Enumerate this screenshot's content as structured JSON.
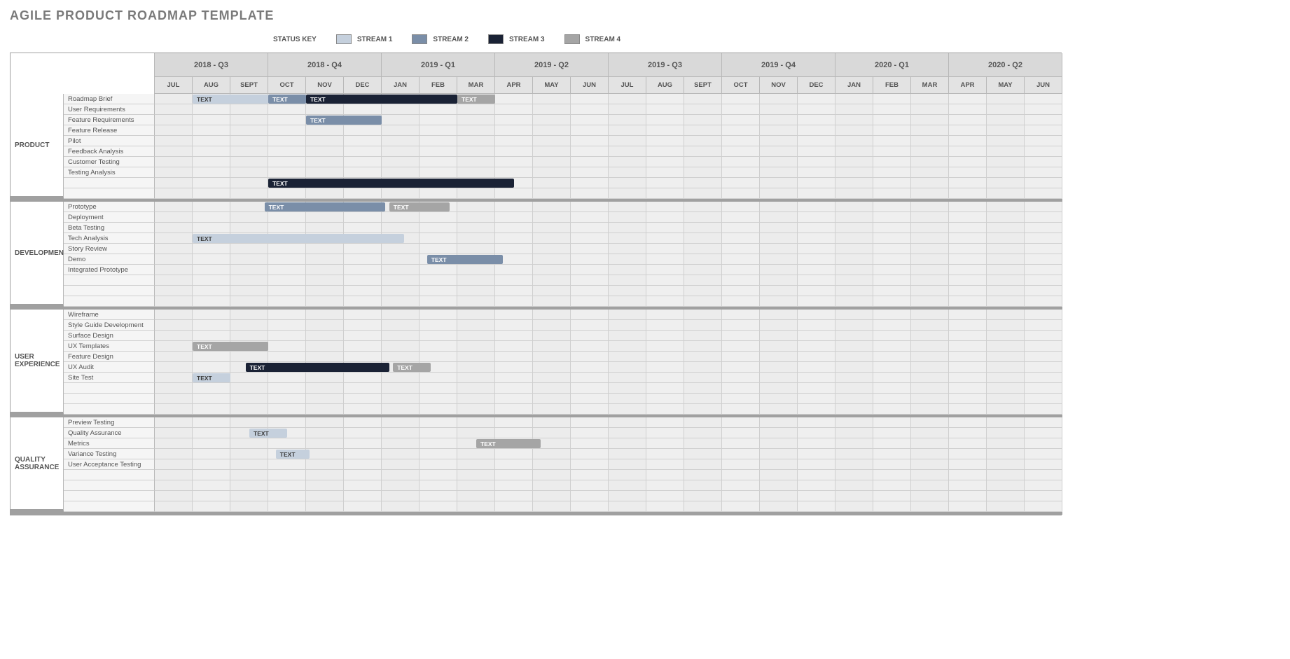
{
  "title": "AGILE PRODUCT ROADMAP TEMPLATE",
  "legend": {
    "key": "STATUS KEY",
    "items": [
      {
        "label": "STREAM 1",
        "cls": "s1"
      },
      {
        "label": "STREAM 2",
        "cls": "s2"
      },
      {
        "label": "STREAM 3",
        "cls": "s3"
      },
      {
        "label": "STREAM 4",
        "cls": "s4"
      }
    ]
  },
  "quarters": [
    "2018 - Q3",
    "2018 - Q4",
    "2019 - Q1",
    "2019 - Q2",
    "2019 - Q3",
    "2019 - Q4",
    "2020 - Q1",
    "2020 - Q2"
  ],
  "months": [
    "JUL",
    "AUG",
    "SEPT",
    "OCT",
    "NOV",
    "DEC",
    "JAN",
    "FEB",
    "MAR",
    "APR",
    "MAY",
    "JUN",
    "JUL",
    "AUG",
    "SEPT",
    "OCT",
    "NOV",
    "DEC",
    "JAN",
    "FEB",
    "MAR",
    "APR",
    "MAY",
    "JUN"
  ],
  "chart_data": {
    "type": "gantt",
    "x_unit": "month-index (0=JUL 2018)",
    "months": [
      "JUL",
      "AUG",
      "SEPT",
      "OCT",
      "NOV",
      "DEC",
      "JAN",
      "FEB",
      "MAR",
      "APR",
      "MAY",
      "JUN",
      "JUL",
      "AUG",
      "SEPT",
      "OCT",
      "NOV",
      "DEC",
      "JAN",
      "FEB",
      "MAR",
      "APR",
      "MAY",
      "JUN"
    ],
    "quarters": [
      "2018 - Q3",
      "2018 - Q4",
      "2019 - Q1",
      "2019 - Q2",
      "2019 - Q3",
      "2019 - Q4",
      "2020 - Q1",
      "2020 - Q2"
    ],
    "streams": {
      "s1": "STREAM 1",
      "s2": "STREAM 2",
      "s3": "STREAM 3",
      "s4": "STREAM 4"
    },
    "sections": [
      {
        "name": "PRODUCT",
        "rows": [
          {
            "task": "Roadmap Brief",
            "bars": [
              {
                "start": 1.0,
                "span": 2.0,
                "stream": "s1",
                "text": "TEXT"
              },
              {
                "start": 3.0,
                "span": 1.0,
                "stream": "s2",
                "text": "TEXT"
              },
              {
                "start": 4.0,
                "span": 4.0,
                "stream": "s3",
                "text": "TEXT"
              },
              {
                "start": 8.0,
                "span": 1.0,
                "stream": "s4",
                "text": "TEXT"
              }
            ]
          },
          {
            "task": "User Requirements",
            "bars": []
          },
          {
            "task": "Feature Requirements",
            "bars": [
              {
                "start": 4.0,
                "span": 2.0,
                "stream": "s2",
                "text": "TEXT"
              }
            ]
          },
          {
            "task": "Feature Release",
            "bars": []
          },
          {
            "task": "Pilot",
            "bars": []
          },
          {
            "task": "Feedback Analysis",
            "bars": []
          },
          {
            "task": "Customer Testing",
            "bars": []
          },
          {
            "task": "Testing Analysis",
            "bars": []
          },
          {
            "task": "",
            "bars": [
              {
                "start": 3.0,
                "span": 6.5,
                "stream": "s3",
                "text": "TEXT"
              }
            ]
          },
          {
            "task": "",
            "bars": []
          }
        ]
      },
      {
        "name": "DEVELOPMENT",
        "rows": [
          {
            "task": "Prototype",
            "bars": [
              {
                "start": 2.9,
                "span": 3.2,
                "stream": "s2",
                "text": "TEXT"
              },
              {
                "start": 6.2,
                "span": 1.6,
                "stream": "s4",
                "text": "TEXT"
              }
            ]
          },
          {
            "task": "Deployment",
            "bars": []
          },
          {
            "task": "Beta Testing",
            "bars": []
          },
          {
            "task": "Tech Analysis",
            "bars": [
              {
                "start": 1.0,
                "span": 5.6,
                "stream": "s1",
                "text": "TEXT"
              }
            ]
          },
          {
            "task": "Story Review",
            "bars": []
          },
          {
            "task": "Demo",
            "bars": [
              {
                "start": 7.2,
                "span": 2.0,
                "stream": "s2",
                "text": "TEXT"
              }
            ]
          },
          {
            "task": "Integrated Prototype",
            "bars": []
          },
          {
            "task": "",
            "bars": []
          },
          {
            "task": "",
            "bars": []
          },
          {
            "task": "",
            "bars": []
          }
        ]
      },
      {
        "name": "USER EXPERIENCE",
        "rows": [
          {
            "task": "Wireframe",
            "bars": []
          },
          {
            "task": "Style Guide Development",
            "bars": []
          },
          {
            "task": "Surface Design",
            "bars": []
          },
          {
            "task": "UX Templates",
            "bars": [
              {
                "start": 1.0,
                "span": 2.0,
                "stream": "s4",
                "text": "TEXT"
              }
            ]
          },
          {
            "task": "Feature Design",
            "bars": []
          },
          {
            "task": "UX Audit",
            "bars": [
              {
                "start": 2.4,
                "span": 3.8,
                "stream": "s3",
                "text": "TEXT"
              },
              {
                "start": 6.3,
                "span": 1.0,
                "stream": "s4",
                "text": "TEXT"
              }
            ]
          },
          {
            "task": "Site Test",
            "bars": [
              {
                "start": 1.0,
                "span": 1.0,
                "stream": "s1",
                "text": "TEXT"
              }
            ]
          },
          {
            "task": "",
            "bars": []
          },
          {
            "task": "",
            "bars": []
          },
          {
            "task": "",
            "bars": []
          }
        ]
      },
      {
        "name": "QUALITY ASSURANCE",
        "rows": [
          {
            "task": "Preview Testing",
            "bars": []
          },
          {
            "task": "Quality Assurance",
            "bars": [
              {
                "start": 2.5,
                "span": 1.0,
                "stream": "s1",
                "text": "TEXT"
              }
            ]
          },
          {
            "task": "Metrics",
            "bars": [
              {
                "start": 8.5,
                "span": 1.7,
                "stream": "s4",
                "text": "TEXT"
              }
            ]
          },
          {
            "task": "Variance Testing",
            "bars": [
              {
                "start": 3.2,
                "span": 0.9,
                "stream": "s1",
                "text": "TEXT"
              }
            ]
          },
          {
            "task": "User Acceptance Testing",
            "bars": []
          },
          {
            "task": "",
            "bars": []
          },
          {
            "task": "",
            "bars": []
          },
          {
            "task": "",
            "bars": []
          },
          {
            "task": "",
            "bars": []
          }
        ]
      }
    ]
  }
}
